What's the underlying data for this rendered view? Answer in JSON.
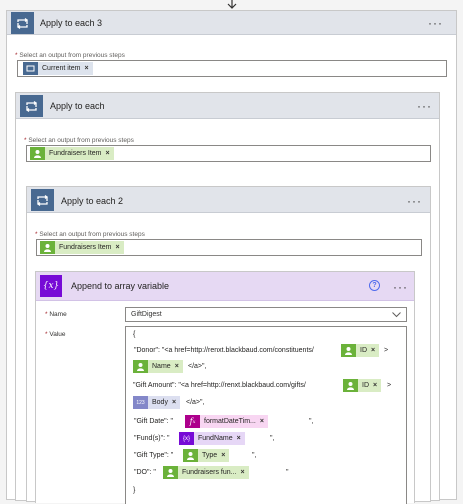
{
  "loops": {
    "outer": {
      "title": "Apply to each 3",
      "select_label": "Select an output from previous steps",
      "token": "Current item"
    },
    "middle": {
      "title": "Apply to each",
      "select_label": "Select an output from previous steps",
      "token": "Fundraisers Item"
    },
    "inner": {
      "title": "Apply to each 2",
      "select_label": "Select an output from previous steps",
      "token": "Fundraisers Item"
    }
  },
  "action": {
    "icon_text": "{x}",
    "title": "Append to array variable",
    "help": "?",
    "name_label": "Name",
    "name_value": "GiftDigest",
    "value_label": "Value",
    "value": {
      "open_brace": "{",
      "close_brace": "}",
      "donor_prefix": "\"Donor\": \"<a href=http://renxt.blackbaud.com/constituents/",
      "donor_id_token": "ID",
      "donor_gt": ">",
      "donor_name_token": "Name",
      "donor_suffix": "</a>\",",
      "gift_amount_prefix": "\"Gift Amount\": \"<a href=http://renxt.blackbaud.com/gifts/",
      "gift_id_token": "ID",
      "gift_gt": ">",
      "gift_body_token": "Body",
      "gift_suffix": "</a>\",",
      "gift_date_prefix": "\"Gift Date\": \"",
      "gift_date_token": "formatDateTim...",
      "gift_date_suffix": "\",",
      "funds_prefix": "\"Fund(s)\": \"",
      "funds_token": "FundName",
      "funds_suffix": "\",",
      "gift_type_prefix": "\"Gift Type\": \"",
      "gift_type_token": "Type",
      "gift_type_suffix": "\",",
      "do_prefix": "\"DO\": \"",
      "do_token": "Fundraisers fun...",
      "do_suffix": "\""
    }
  },
  "required_mark": "*",
  "more_dots": "···",
  "close_x": "×",
  "colors": {
    "loop_header": "#e1e4ea",
    "loop_icon": "#486991",
    "action_header": "#e6d9f3",
    "variable_purple": "#770bd6",
    "blackbaud_green": "#6bb23a",
    "expression_pink": "#ad008c"
  }
}
